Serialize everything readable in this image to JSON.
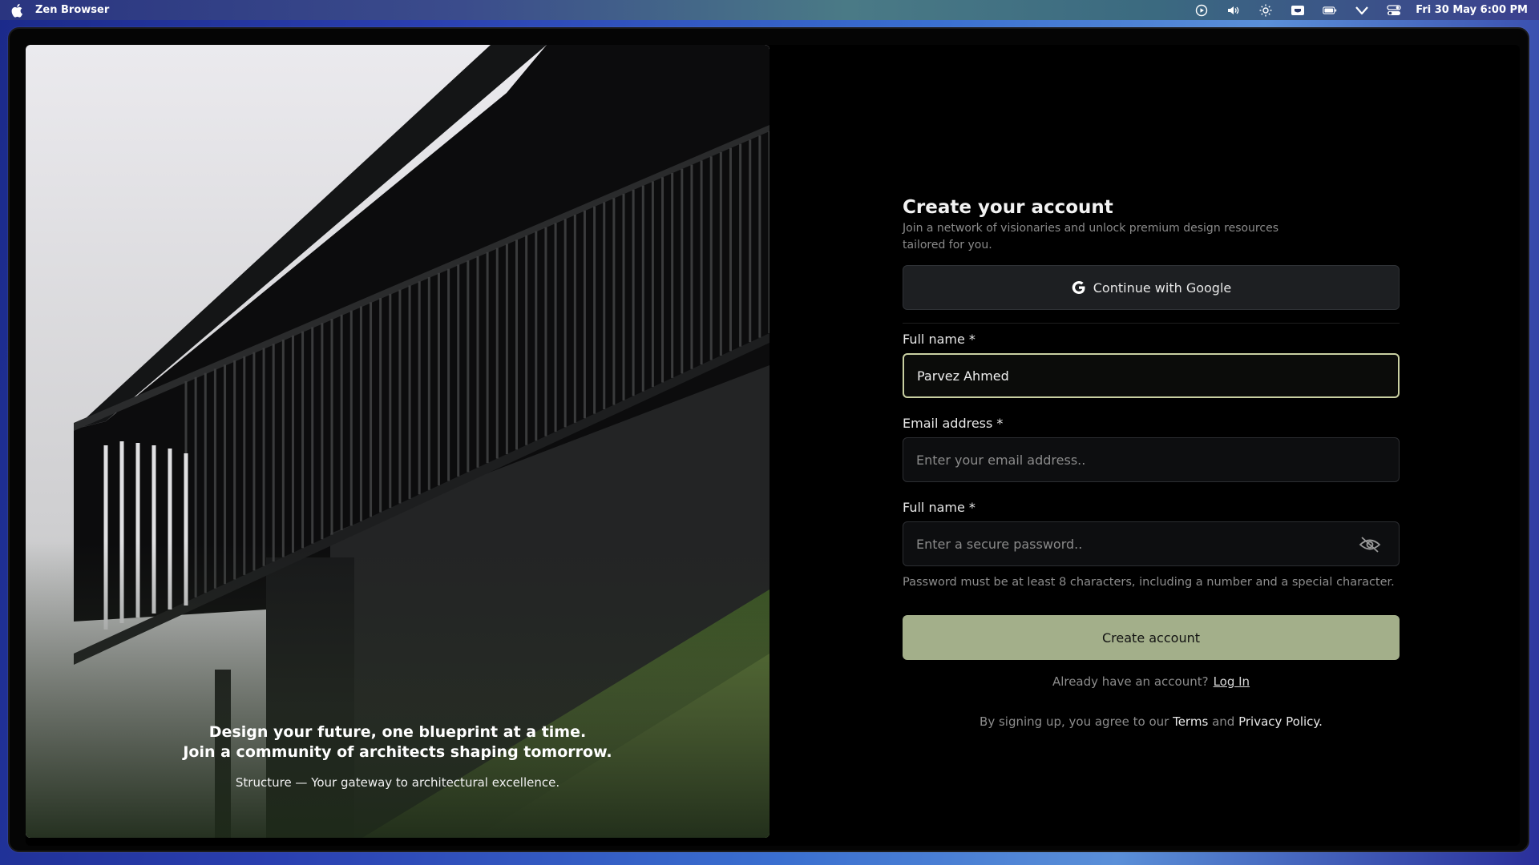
{
  "menubar": {
    "app_name": "Zen Browser",
    "clock": "Fri 30 May  6:00 PM",
    "icons": [
      "play-circle-icon",
      "volume-icon",
      "brightness-icon",
      "keyboard-icon",
      "battery-icon",
      "wifi-icon",
      "control-center-icon"
    ]
  },
  "hero": {
    "headline_line1": "Design your future, one blueprint at a time.",
    "headline_line2": "Join a community of architects shaping tomorrow.",
    "tagline": "Structure — Your gateway to architectural excellence."
  },
  "form": {
    "title": "Create your account",
    "subtitle": "Join a network of visionaries and unlock premium design resources tailored for you.",
    "google_button": "Continue with Google",
    "name_label": "Full name *",
    "name_value": "Parvez Ahmed",
    "email_label": "Email address *",
    "email_placeholder": "Enter your email address..",
    "password_label": "Full name *",
    "password_placeholder": "Enter a secure password..",
    "password_hint": "Password must be at least 8 characters, including a number and a special character.",
    "create_button": "Create account",
    "login_prompt": "Already have an account?",
    "login_link": "Log In",
    "legal_prefix": "By signing up, you agree to our",
    "legal_terms": "Terms",
    "legal_and": "and",
    "legal_privacy": "Privacy Policy."
  },
  "colors": {
    "accent_button": "#a3af8a",
    "active_field_border": "#c9d0a2",
    "background": "#000000"
  }
}
